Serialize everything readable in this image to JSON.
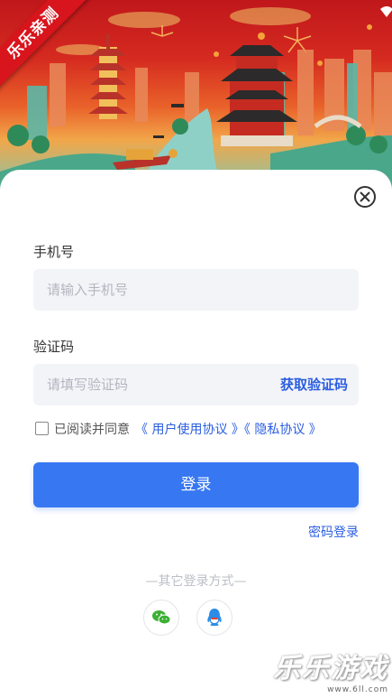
{
  "banner": {
    "ribbon_text": "乐乐亲测"
  },
  "status_bar": {
    "icons": [
      "wifi-icon",
      "signal-icon",
      "battery-icon"
    ]
  },
  "form": {
    "phone_label": "手机号",
    "phone_placeholder": "请输入手机号",
    "code_label": "验证码",
    "code_placeholder": "请填写验证码",
    "get_code_label": "获取验证码"
  },
  "agreement": {
    "prefix": "已阅读并同意",
    "user_agreement": "《 用户使用协议 》",
    "privacy_agreement": "《 隐私协议 》",
    "checked": false
  },
  "actions": {
    "login_label": "登录",
    "password_login_label": "密码登录"
  },
  "other_login": {
    "title": "—其它登录方式—",
    "options": [
      {
        "icon": "wechat-icon",
        "color": "#3cb034"
      },
      {
        "icon": "qq-icon",
        "color": "#2a8ce8"
      }
    ]
  },
  "watermark": {
    "text": "乐乐游戏",
    "url": "www.6ll.com"
  },
  "colors": {
    "accent": "#3777f2",
    "link": "#2a5de0",
    "input_bg": "#f3f4f8"
  }
}
